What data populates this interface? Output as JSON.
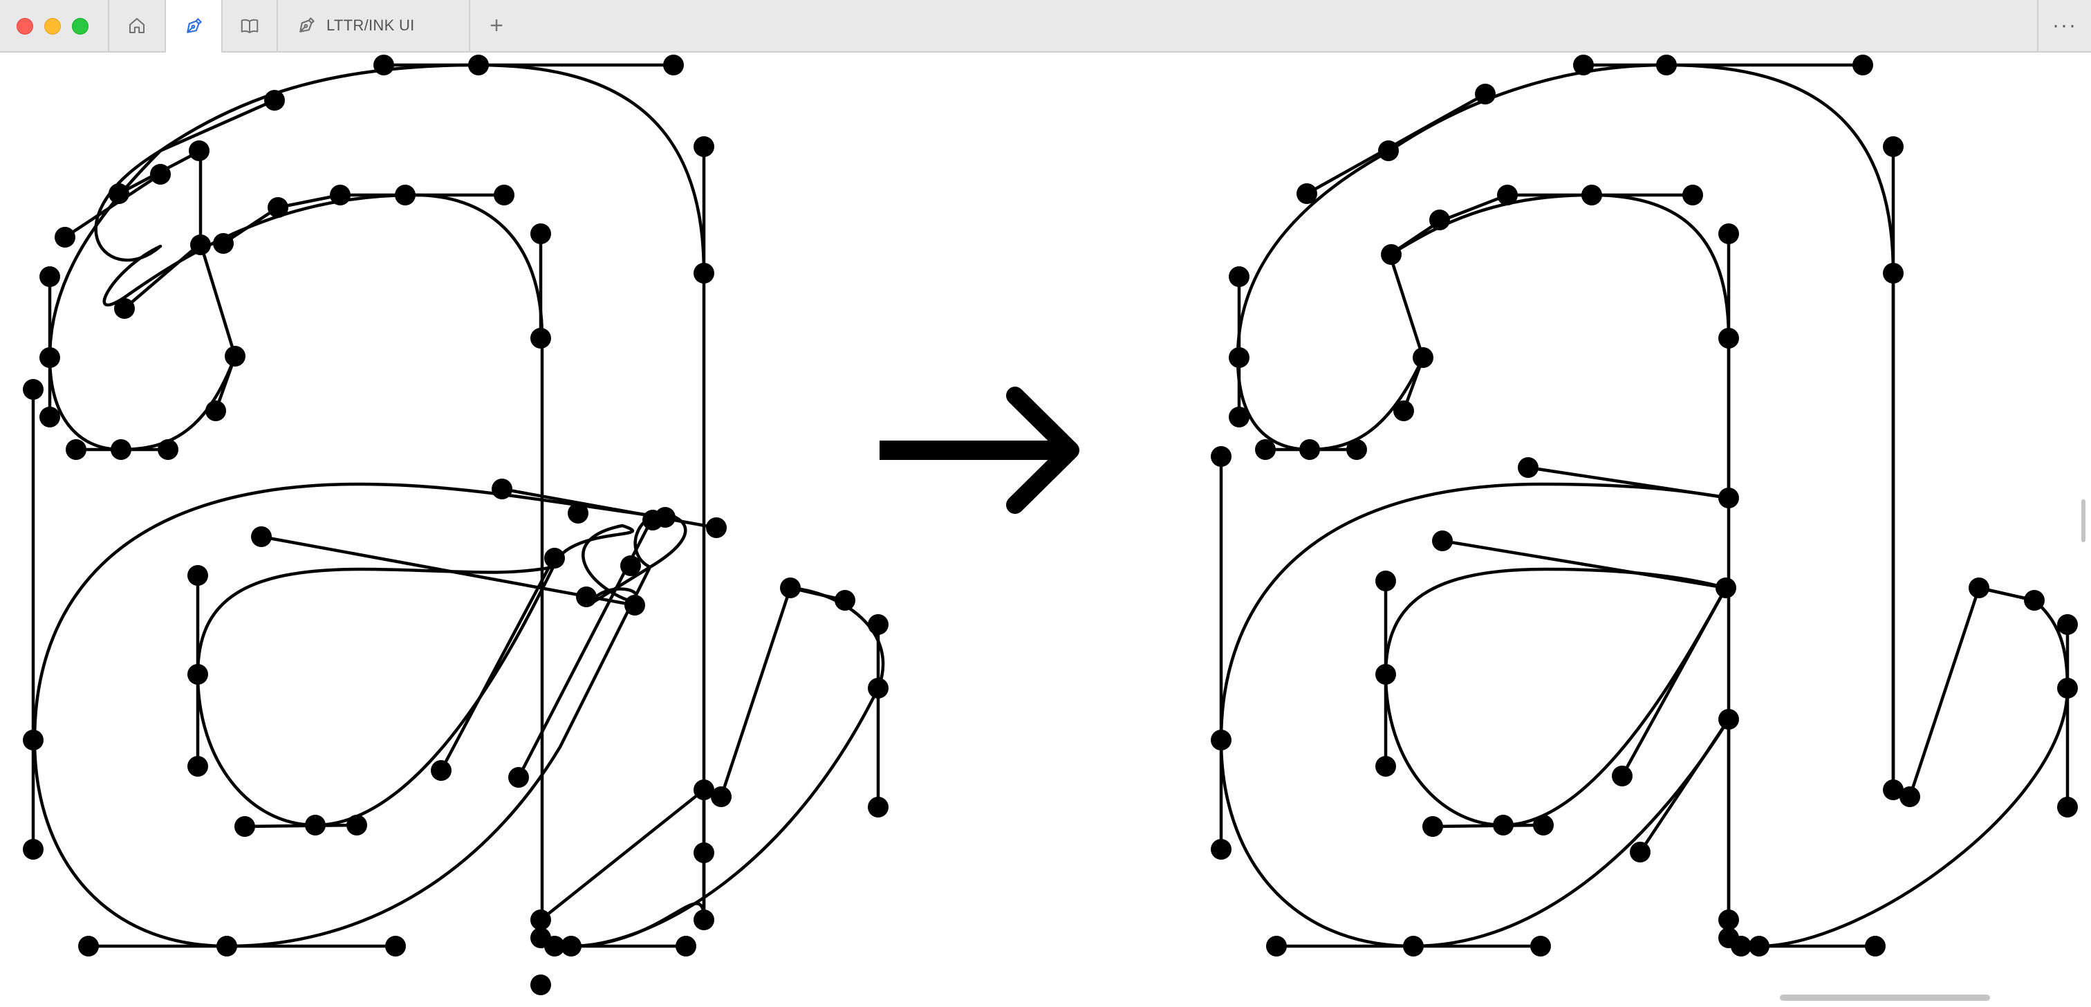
{
  "window": {
    "tabs": [
      {
        "icon": "home-icon"
      },
      {
        "icon": "pen-tool-icon",
        "active": true
      },
      {
        "icon": "book-icon"
      },
      {
        "icon": "pen-tool-icon",
        "label": "LTTR/INK UI"
      }
    ],
    "add_tab_label": "+",
    "more_label": "···"
  },
  "colors": {
    "tab_bar": "#e9e9e9",
    "ink": "#000000",
    "active_tab_icon": "#2f6fdf"
  }
}
